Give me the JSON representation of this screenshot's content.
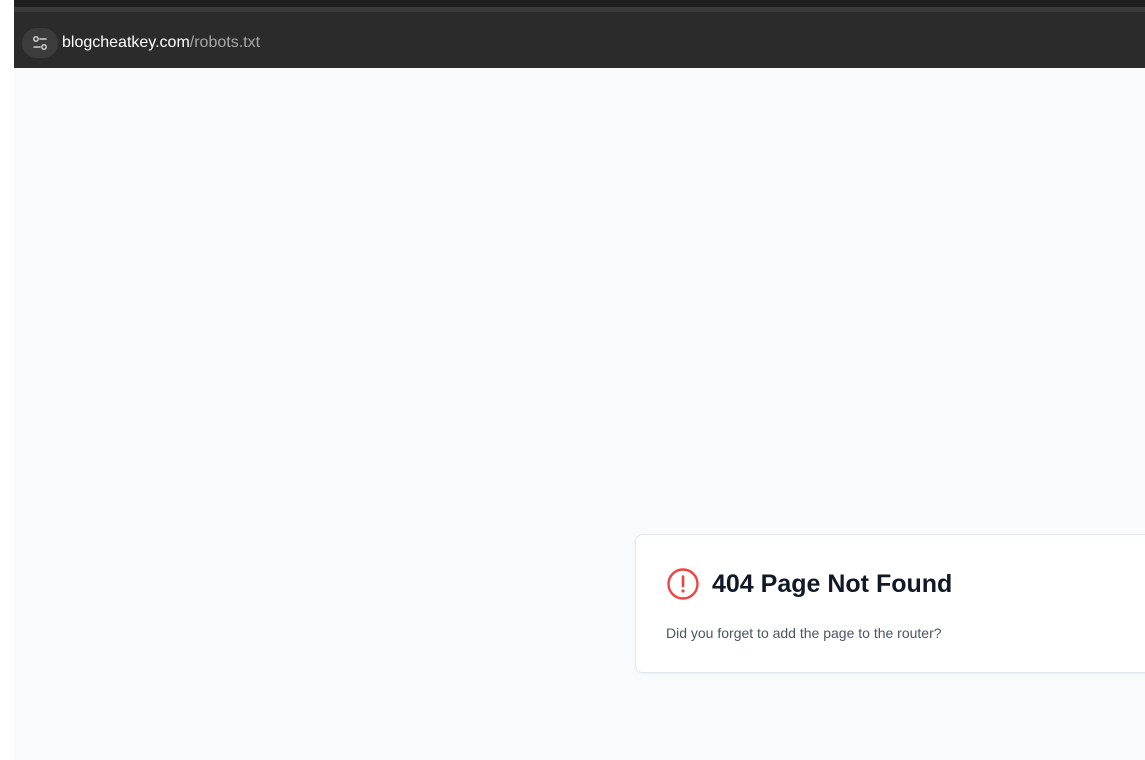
{
  "browser": {
    "url_domain": "blogcheatkey.com",
    "url_path": "/robots.txt",
    "site_info_icon": "tune-icon"
  },
  "error_card": {
    "icon": "alert-circle-icon",
    "icon_color": "#ef4444",
    "title": "404 Page Not Found",
    "message": "Did you forget to add the page to the router?"
  },
  "colors": {
    "page_background": "#f8fafc",
    "toolbar_background": "#2b2b2b",
    "title_text": "#111827",
    "body_text": "#4b5563"
  }
}
